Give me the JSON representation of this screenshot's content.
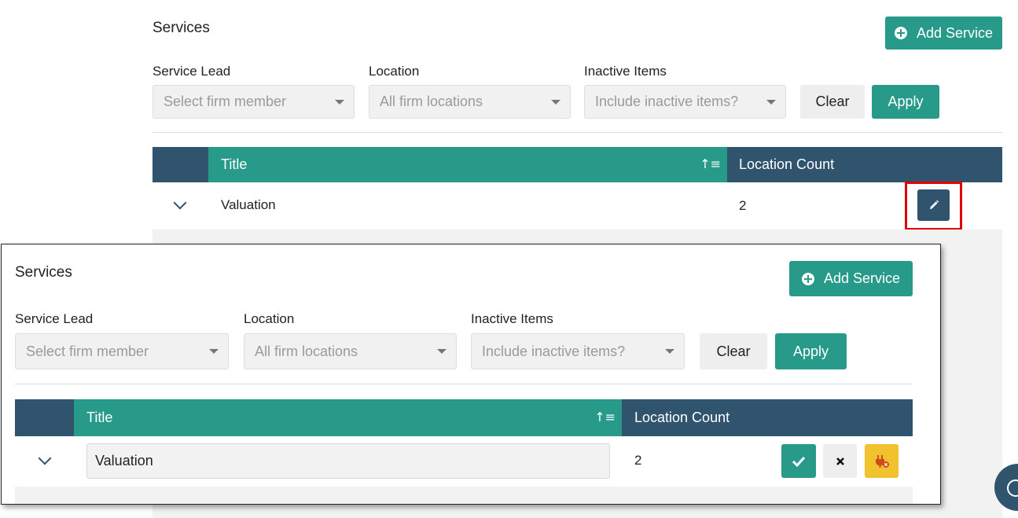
{
  "background": {
    "page_title": "Services",
    "add_service_label": "Add Service",
    "filters": {
      "service_lead": {
        "label": "Service Lead",
        "placeholder": "Select firm member"
      },
      "location": {
        "label": "Location",
        "placeholder": "All firm locations"
      },
      "inactive": {
        "label": "Inactive Items",
        "placeholder": "Include inactive items?"
      }
    },
    "clear_label": "Clear",
    "apply_label": "Apply",
    "table": {
      "columns": [
        "Title",
        "Location Count"
      ],
      "rows": [
        {
          "title": "Valuation",
          "location_count": "2"
        }
      ]
    }
  },
  "overlay": {
    "page_title": "Services",
    "add_service_label": "Add Service",
    "filters": {
      "service_lead": {
        "label": "Service Lead",
        "placeholder": "Select firm member"
      },
      "location": {
        "label": "Location",
        "placeholder": "All firm locations"
      },
      "inactive": {
        "label": "Inactive Items",
        "placeholder": "Include inactive items?"
      }
    },
    "clear_label": "Clear",
    "apply_label": "Apply",
    "table": {
      "columns": [
        "Title",
        "Location Count"
      ],
      "rows": [
        {
          "title_value": "Valuation",
          "location_count": "2"
        }
      ]
    }
  },
  "icons": {
    "add": "plus-circle-icon",
    "sort": "sort-ascending-icon",
    "expand": "chevron-down-icon",
    "edit": "pencil-icon",
    "save": "check-icon",
    "cancel": "close-icon",
    "deactivate": "plug-deactivate-icon"
  },
  "colors": {
    "primary": "#279a8a",
    "header_dark": "#30536e",
    "highlight": "#e00000",
    "warning": "#f2c12e"
  }
}
